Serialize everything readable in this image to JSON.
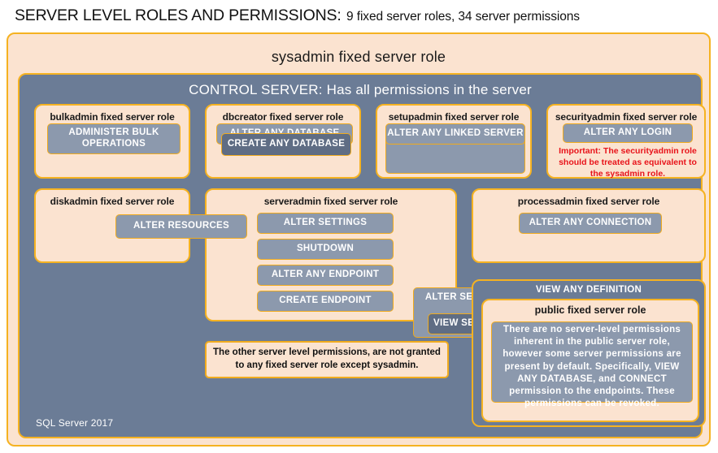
{
  "title": {
    "strong": "SERVER LEVEL ROLES AND PERMISSIONS:",
    "rest": "9 fixed server roles, 34 server permissions"
  },
  "sysadmin": {
    "label": "sysadmin  fixed  server  role"
  },
  "control_server": {
    "label": "CONTROL SERVER: Has all permissions in the server"
  },
  "footer": {
    "version": "SQL Server 2017"
  },
  "roles": {
    "bulkadmin": {
      "label": "bulkadmin  fixed server role",
      "permissions": [
        "ADMINISTER  BULK OPERATIONS"
      ]
    },
    "dbcreator": {
      "label": "dbcreator fixed server role",
      "permissions": [
        "ALTER ANY DATABASE",
        "CREATE  ANY DATABASE"
      ]
    },
    "setupadmin": {
      "label": "setupadmin fixed server role",
      "permissions": [
        "ALTER ANY LINKED SERVER"
      ]
    },
    "securityadmin": {
      "label": "securityadmin  fixed server role",
      "permissions": [
        "ALTER ANY LOGIN"
      ],
      "warning": "Important:  The securityadmin role should  be treated as equivalent to the  sysadmin role."
    },
    "diskadmin": {
      "label": "diskadmin  fixed server role",
      "permissions": [
        "ALTER RESOURCES"
      ]
    },
    "serveradmin": {
      "label": "serveradmin fixed server role",
      "permissions": [
        "ALTER SETTINGS",
        "SHUTDOWN",
        "ALTER ANY ENDPOINT",
        "CREATE  ENDPOINT"
      ],
      "shared_permissions": [
        "ALTER SERVER STATE",
        "VIEW SERVER STATE"
      ]
    },
    "processadmin": {
      "label": "processadmin fixed server role",
      "permissions": [
        "ALTER ANY CONNECTION"
      ]
    },
    "public": {
      "outer_label": "VIEW ANY DEFINITION",
      "label": "public  fixed server role",
      "note": "There are no server-level permissions inherent in  the public  server role, however some server permissions  are present by default. Specifically,  VIEW ANY DATABASE, and CONNECT permission to the endpoints. These permissions can be revoked."
    }
  },
  "notes": {
    "other_permissions": "The other server level permissions,  are not granted to any fixed server role except sysadmin."
  },
  "colors": {
    "cream": "#fbe3d0",
    "gold_border": "#f5b221",
    "panel_blue": "#6b7c96",
    "permission_blue": "#8c99ad",
    "permission_blue_dark": "#5f6d84",
    "warning_red": "#e8131a"
  }
}
